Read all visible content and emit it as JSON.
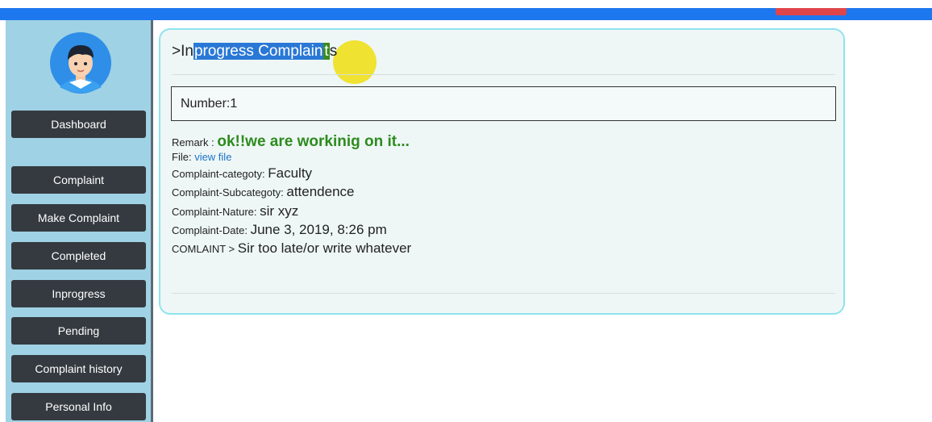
{
  "sidebar": {
    "items": [
      {
        "label": "Dashboard"
      },
      {
        "label": "Complaint"
      },
      {
        "label": "Make Complaint"
      },
      {
        "label": "Completed"
      },
      {
        "label": "Inprogress"
      },
      {
        "label": "Pending"
      },
      {
        "label": "Complaint history"
      },
      {
        "label": "Personal Info"
      }
    ]
  },
  "page": {
    "title_prefix": ">In",
    "title_selected": "progress Complain",
    "title_cursor_part": "t",
    "title_suffix": "s"
  },
  "complaint": {
    "number": "Number:1",
    "remark_label": "Remark :",
    "remark_value": "ok!!we are workinig on it...",
    "file_label": "File:",
    "file_link": "view file",
    "category_label": "Complaint-categoty:",
    "category_value": "Faculty",
    "subcategory_label": "Complaint-Subcategoty:",
    "subcategory_value": "attendence",
    "nature_label": "Complaint-Nature:",
    "nature_value": "sir xyz",
    "date_label": "Complaint-Date:",
    "date_value": "June 3, 2019, 8:26 pm",
    "comlaint_label": "COMLAINT >",
    "comlaint_value": "Sir too late/or write whatever"
  },
  "colors": {
    "topbar": "#1d77ee",
    "sidebar": "#9fd2e4",
    "nav_button": "#343a40",
    "remark": "#2e8b1e",
    "link": "#1e73c8",
    "card_border": "#8fe3ee"
  },
  "icons": {
    "avatar": "user-avatar-icon"
  }
}
